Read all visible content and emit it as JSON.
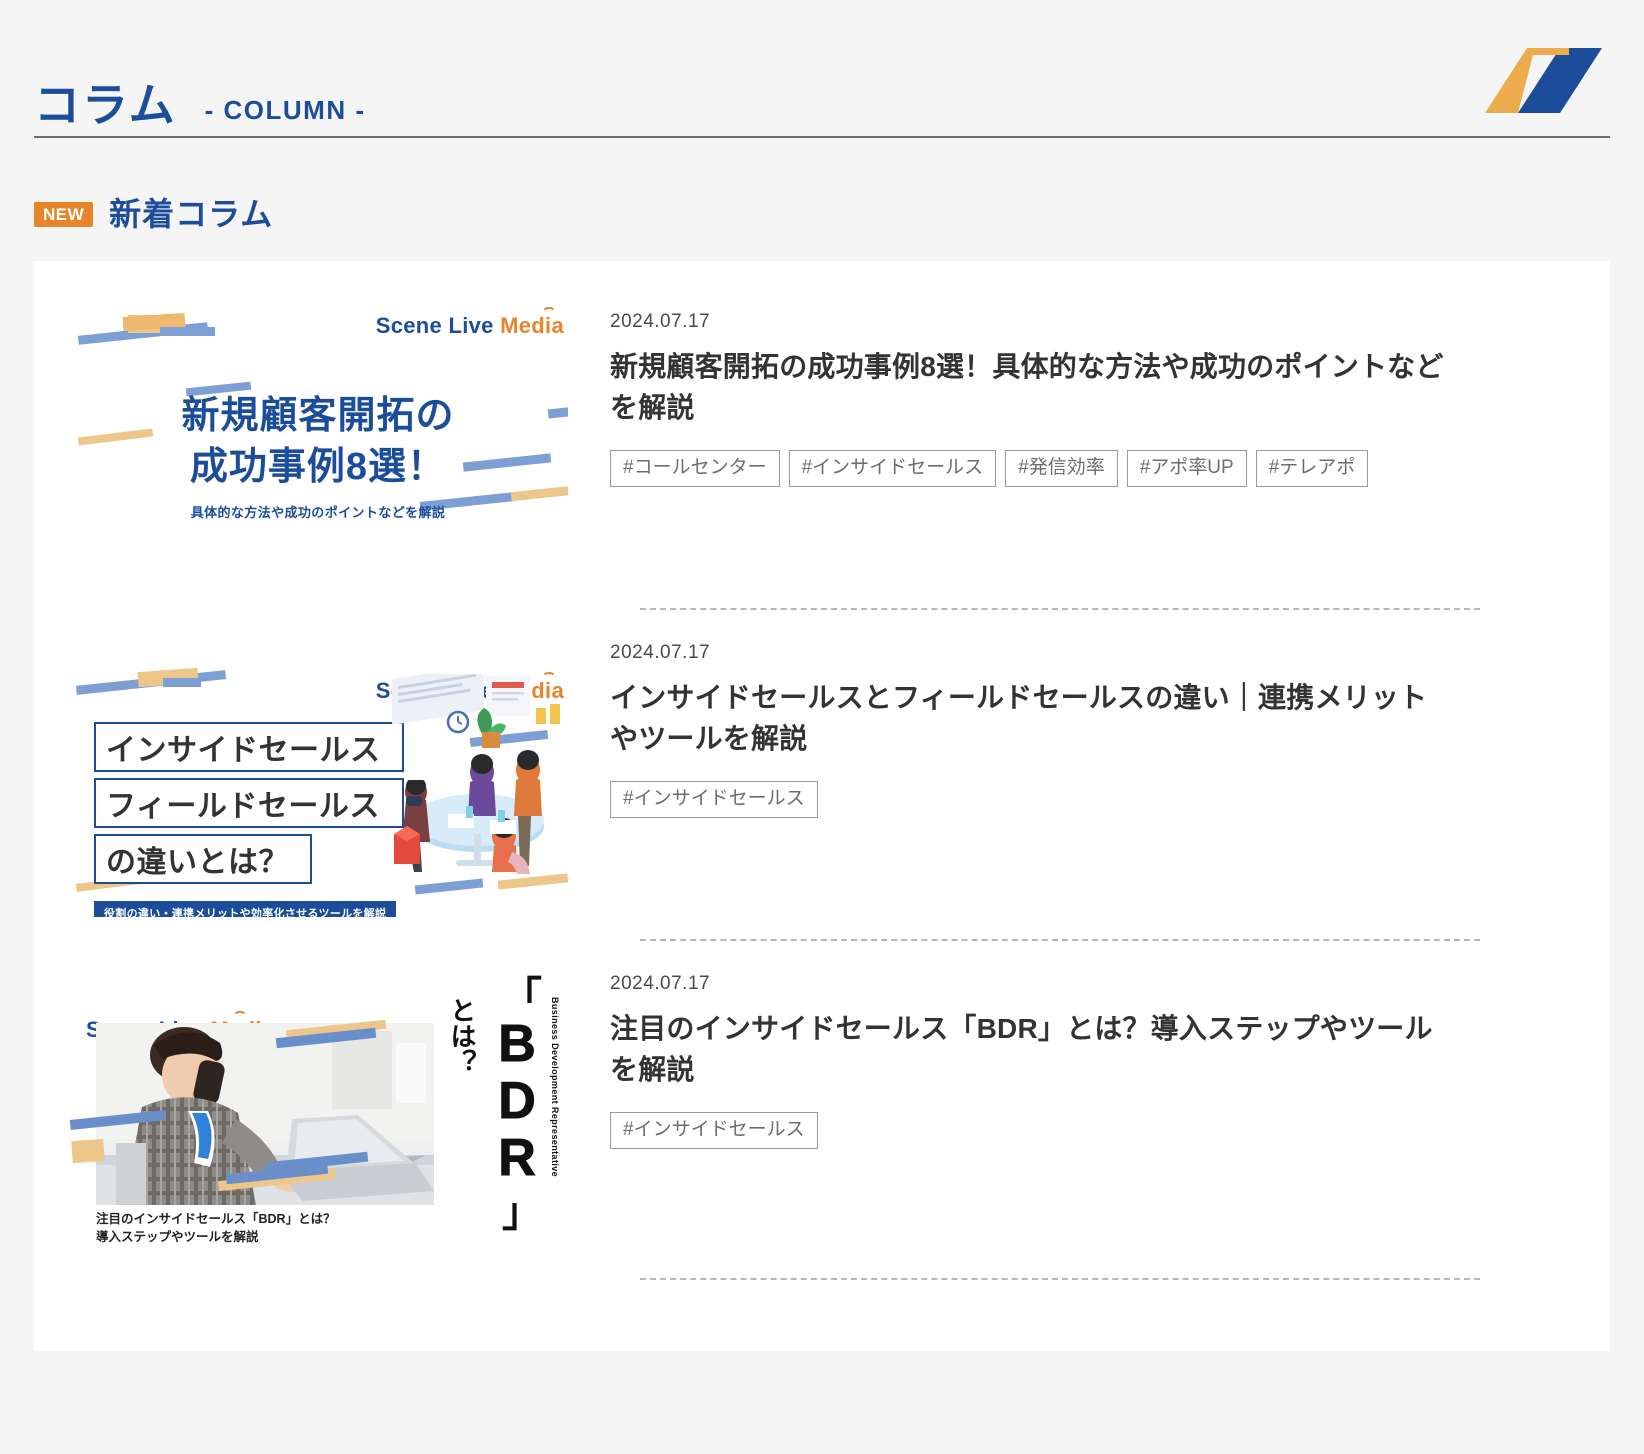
{
  "header": {
    "title_ja": "コラム",
    "title_en": "- COLUMN -",
    "logo_name": "scene-live-mark"
  },
  "section": {
    "badge": "NEW",
    "title": "新着コラム"
  },
  "articles": [
    {
      "date": "2024.07.17",
      "title": "新規顧客開拓の成功事例8選！具体的な方法や成功のポイントなどを解説",
      "tags": [
        "#コールセンター",
        "#インサイドセールス",
        "#発信効率",
        "#アポ率UP",
        "#テレアポ"
      ],
      "thumb": {
        "brand_s1": "Scene Live ",
        "brand_s2": "Media",
        "line1": "新規顧客開拓の",
        "line2": "成功事例8選！",
        "sub": "具体的な方法や成功のポイントなどを解説"
      }
    },
    {
      "date": "2024.07.17",
      "title": "インサイドセールスとフィールドセールスの違い｜連携メリットやツールを解説",
      "tags": [
        "#インサイドセールス"
      ],
      "thumb": {
        "brand_s1": "Scene Live ",
        "brand_s2": "Media",
        "box1": "インサイドセールス",
        "box2": "フィールドセールス",
        "box3": "の違いとは？",
        "banner": "役割の違い・連携メリットや効率化させるツールを解説"
      }
    },
    {
      "date": "2024.07.17",
      "title": "注目のインサイドセールス「BDR」とは？導入ステップやツールを解説",
      "tags": [
        "#インサイドセールス"
      ],
      "thumb": {
        "brand_s1": "Scene Live ",
        "brand_s2": "Media",
        "bdr_letters": "BDR",
        "bdr_toha": "とは？",
        "bdr_english": "Business Development Representative",
        "caption_line1": "注目のインサイドセールス「BDR」とは？",
        "caption_line2": "導入ステップやツールを解説"
      }
    }
  ],
  "colors": {
    "brand_blue": "#1b4d9b",
    "brand_orange": "#e8842a",
    "page_bg": "#f5f5f5",
    "card_bg": "#ffffff",
    "title_text": "#333333",
    "tag_border": "#9a9a9a"
  }
}
